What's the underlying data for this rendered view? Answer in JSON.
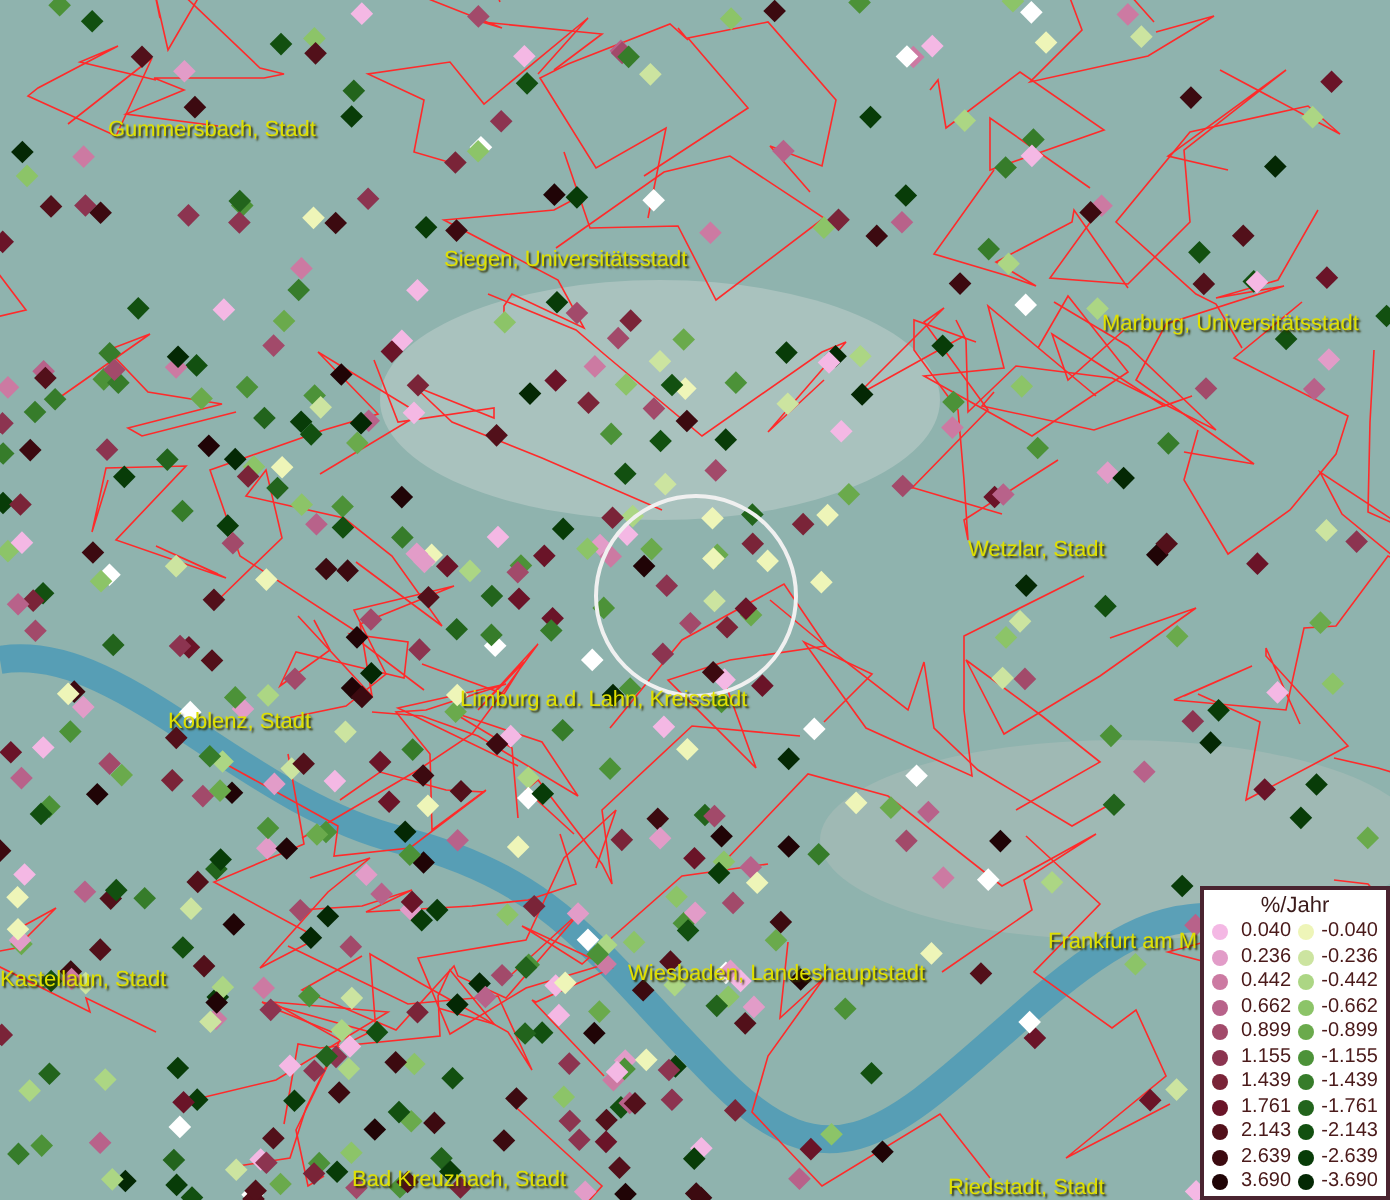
{
  "map": {
    "places": [
      {
        "name": "Gummersbach, Stadt"
      },
      {
        "name": "Siegen, Universitätsstadt"
      },
      {
        "name": "Marburg, Universitätsstadt"
      },
      {
        "name": "Wetzlar, Stadt"
      },
      {
        "name": "Koblenz, Stadt"
      },
      {
        "name": "Limburg a.d. Lahn, Kreisstadt"
      },
      {
        "name": "Kastellaun, Stadt"
      },
      {
        "name": "Wiesbaden, Landeshauptstadt"
      },
      {
        "name": "Frankfurt am M"
      },
      {
        "name": "Bad Kreuznach, Stadt"
      },
      {
        "name": "Riedstadt, Stadt"
      }
    ]
  },
  "legend": {
    "title": "%/Jahr",
    "rows": [
      {
        "left": {
          "value": "0.040",
          "color": "#f4b8e4"
        },
        "right": {
          "value": "-0.040",
          "color": "#eef5b8"
        }
      },
      {
        "left": {
          "value": "0.236",
          "color": "#e29cc8"
        },
        "right": {
          "value": "-0.236",
          "color": "#cce4a0"
        }
      },
      {
        "left": {
          "value": "0.442",
          "color": "#cc7aa2"
        },
        "right": {
          "value": "-0.442",
          "color": "#acd684"
        }
      },
      {
        "left": {
          "value": "0.662",
          "color": "#b8628a"
        },
        "right": {
          "value": "-0.662",
          "color": "#8cc468"
        }
      },
      {
        "left": {
          "value": "0.899",
          "color": "#a24a6a"
        },
        "right": {
          "value": "-0.899",
          "color": "#6aaa4c"
        }
      },
      {
        "left": {
          "value": "1.155",
          "color": "#8c3450"
        },
        "right": {
          "value": "-1.155",
          "color": "#4c9238"
        }
      },
      {
        "left": {
          "value": "1.439",
          "color": "#7a2438"
        },
        "right": {
          "value": "-1.439",
          "color": "#367c2a"
        }
      },
      {
        "left": {
          "value": "1.761",
          "color": "#6a1428"
        },
        "right": {
          "value": "-1.761",
          "color": "#22641c"
        }
      },
      {
        "left": {
          "value": "2.143",
          "color": "#52101a"
        },
        "right": {
          "value": "-2.143",
          "color": "#125010"
        }
      },
      {
        "left": {
          "value": "2.639",
          "color": "#3c0a10"
        },
        "right": {
          "value": "-2.639",
          "color": "#083c08"
        }
      },
      {
        "left": {
          "value": "3.690",
          "color": "#200406"
        },
        "right": {
          "value": "-3.690",
          "color": "#042804"
        }
      }
    ]
  }
}
